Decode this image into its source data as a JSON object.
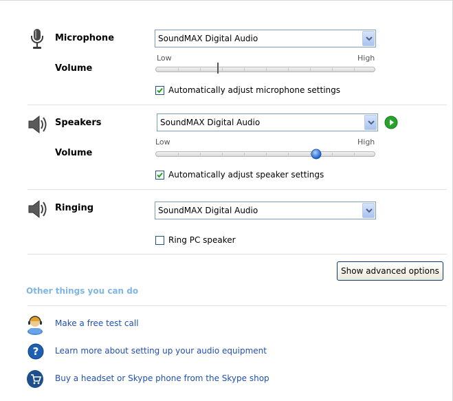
{
  "microphone": {
    "label": "Microphone",
    "device": "SoundMAX Digital Audio",
    "volume_label": "Volume",
    "low_label": "Low",
    "high_label": "High",
    "volume_level_fraction": 0.28,
    "auto_adjust_label": "Automatically adjust microphone settings",
    "auto_adjust_checked": true
  },
  "speakers": {
    "label": "Speakers",
    "device": "SoundMAX Digital Audio",
    "volume_label": "Volume",
    "low_label": "Low",
    "high_label": "High",
    "volume_level_fraction": 0.73,
    "auto_adjust_label": "Automatically adjust speaker settings",
    "auto_adjust_checked": true
  },
  "ringing": {
    "label": "Ringing",
    "device": "SoundMAX Digital Audio",
    "ring_pc_label": "Ring PC speaker",
    "ring_pc_checked": false
  },
  "advanced_button_label": "Show advanced options",
  "other": {
    "heading": "Other things you can do",
    "links": [
      {
        "label": "Make a free test call",
        "icon": "test-call-icon"
      },
      {
        "label": "Learn more about setting up your audio equipment",
        "icon": "help-icon"
      },
      {
        "label": "Buy a headset or Skype phone from the Skype shop",
        "icon": "shop-icon"
      }
    ]
  },
  "colors": {
    "link": "#1f4fb4",
    "heading": "#7fb6e6",
    "checkbox_border": "#1c5180",
    "check_mark": "#21a121"
  }
}
